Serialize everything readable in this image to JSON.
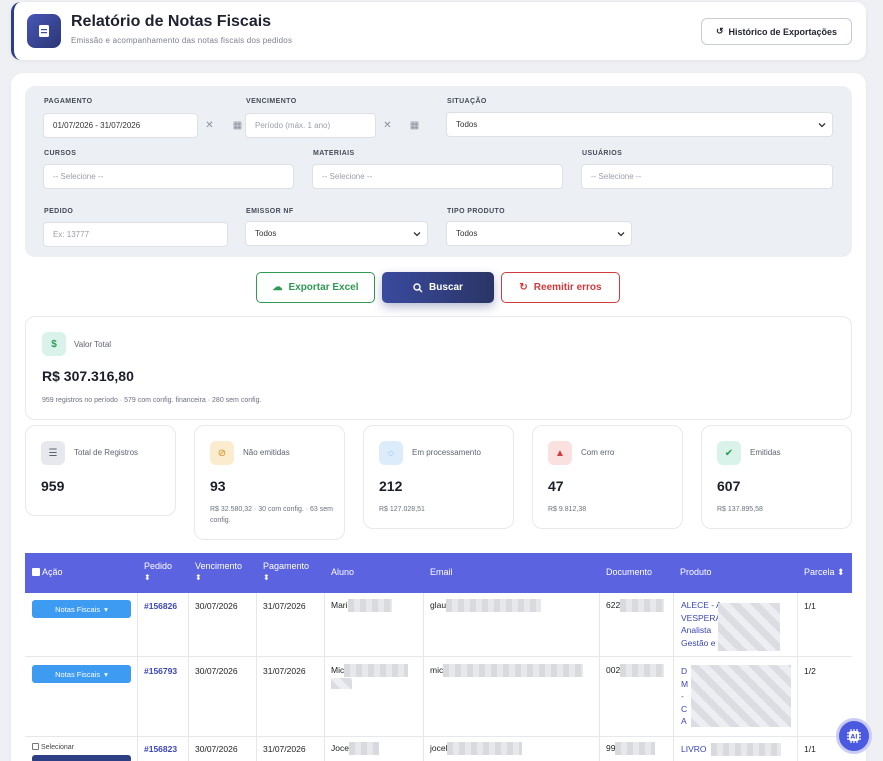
{
  "header": {
    "title": "Relatório de Notas Fiscais",
    "subtitle": "Emissão e acompanhamento das notas fiscais dos pedidos",
    "history_button": "Histórico de Exportações"
  },
  "filters": {
    "pagamento": {
      "label": "PAGAMENTO",
      "value": "01/07/2026 - 31/07/2026"
    },
    "vencimento": {
      "label": "VENCIMENTO",
      "placeholder": "Período (máx. 1 ano)"
    },
    "situacao": {
      "label": "SITUAÇÃO",
      "value": "Todos"
    },
    "cursos": {
      "label": "CURSOS",
      "placeholder": "-- Selecione --"
    },
    "materiais": {
      "label": "MATERIAIS",
      "placeholder": "-- Selecione --"
    },
    "usuarios": {
      "label": "USUÁRIOS",
      "placeholder": "-- Selecione --"
    },
    "pedido": {
      "label": "PEDIDO",
      "placeholder": "Ex: 13777"
    },
    "emissor": {
      "label": "EMISSOR NF",
      "value": "Todos"
    },
    "tipo_produto": {
      "label": "TIPO PRODUTO",
      "value": "Todos"
    }
  },
  "actions": {
    "export": "Exportar Excel",
    "search": "Buscar",
    "reissue": "Reemitir erros"
  },
  "total": {
    "label": "Valor Total",
    "value": "R$ 307.316,80",
    "sub": "959 registros no período · 579 com config. financeira · 280 sem config."
  },
  "stats": [
    {
      "label": "Total de Registros",
      "value": "959",
      "sub": "",
      "color": "#6b7180"
    },
    {
      "label": "Não emitidas",
      "value": "93",
      "sub": "R$ 32.580,32 · 30 com config. · 63 sem config.",
      "color": "#e0a03a"
    },
    {
      "label": "Em processamento",
      "value": "212",
      "sub": "R$ 127.028,51",
      "color": "#3d9bf2"
    },
    {
      "label": "Com erro",
      "value": "47",
      "sub": "R$ 9.812,38",
      "color": "#d23b3b"
    },
    {
      "label": "Emitidas",
      "value": "607",
      "sub": "R$ 137.895,58",
      "color": "#2f9a52"
    }
  ],
  "table": {
    "columns": {
      "acao": "Ação",
      "pedido": "Pedido",
      "vencimento": "Vencimento",
      "pagamento": "Pagamento",
      "aluno": "Aluno",
      "email": "Email",
      "documento": "Documento",
      "produto": "Produto",
      "parcela": "Parcela"
    },
    "nf_button": "Notas Fiscais",
    "select_label": "Selecionar",
    "rows": [
      {
        "pedido": "#156826",
        "vencimento": "30/07/2026",
        "pagamento": "31/07/2026",
        "aluno": "Mari",
        "email": "glau",
        "documento": "622",
        "produto": [
          "ALECE - A",
          "VESPERA",
          "Analista",
          "Gestão e"
        ],
        "parcela": "1/1"
      },
      {
        "pedido": "#156793",
        "vencimento": "30/07/2026",
        "pagamento": "31/07/2026",
        "aluno": "Mic",
        "email": "mic",
        "documento": "002",
        "produto": [
          "D",
          "M",
          "-",
          "C",
          "A"
        ],
        "parcela": "1/2"
      },
      {
        "pedido": "#156823",
        "vencimento": "30/07/2026",
        "pagamento": "31/07/2026",
        "aluno": "Joce",
        "email": "jocel",
        "documento": "99",
        "produto": [
          "LIVRO"
        ],
        "parcela": "1/1"
      }
    ]
  }
}
